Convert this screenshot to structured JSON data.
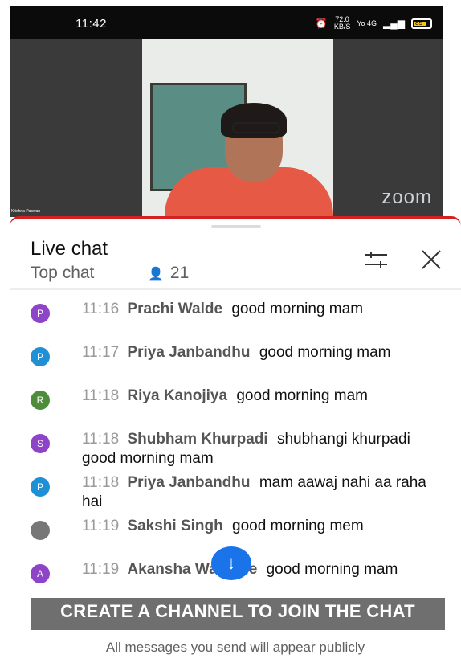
{
  "status_bar": {
    "time": "11:42",
    "speed_top": "72.0",
    "speed_bottom": "KB/S",
    "network": "Yo 4G",
    "battery": "85"
  },
  "video": {
    "participant_name": "Krishna Paswan",
    "watermark": "zoom"
  },
  "chat_header": {
    "title": "Live chat",
    "mode": "Top chat",
    "viewer_count": "21"
  },
  "messages": [
    {
      "avatar": "P",
      "avatar_color": "#8e44c7",
      "time": "11:16",
      "author": "Prachi Walde",
      "text": "good morning mam"
    },
    {
      "avatar": "P",
      "avatar_color": "#1f8fd6",
      "time": "11:17",
      "author": "Priya Janbandhu",
      "text": "good morning mam"
    },
    {
      "avatar": "R",
      "avatar_color": "#4d8c3a",
      "time": "11:18",
      "author": "Riya Kanojiya",
      "text": "good morning mam"
    },
    {
      "avatar": "S",
      "avatar_color": "#8e44c7",
      "time": "11:18",
      "author": "Shubham Khurpadi",
      "text": "shubhangi khurpadi good morning mam"
    },
    {
      "avatar": "P",
      "avatar_color": "#1f8fd6",
      "time": "11:18",
      "author": "Priya Janbandhu",
      "text": "mam aawaj nahi aa raha hai"
    },
    {
      "avatar": "",
      "avatar_color": "#777777",
      "time": "11:19",
      "author": "Sakshi Singh",
      "text": "good morning mem"
    },
    {
      "avatar": "A",
      "avatar_color": "#8e44c7",
      "time": "11:19",
      "author": "Akansha Wankule",
      "text": "good morning mam"
    }
  ],
  "create_channel_label": "CREATE A CHANNEL TO JOIN THE CHAT",
  "notice": "All messages you send will appear publicly"
}
